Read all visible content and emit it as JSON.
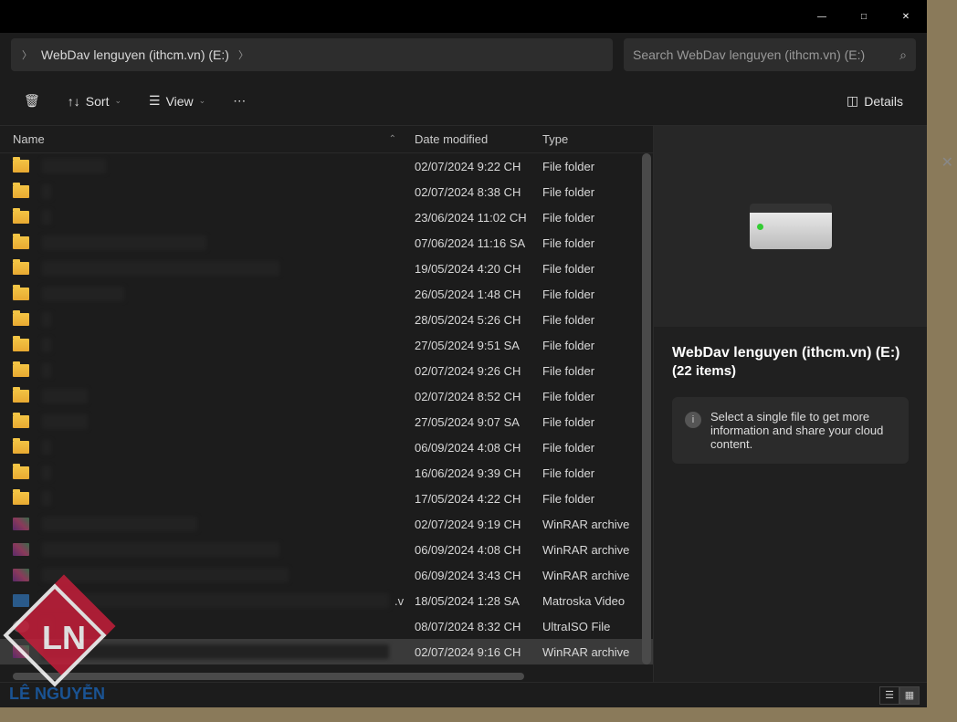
{
  "titlebar": {
    "min": "—",
    "max": "□",
    "close": "✕"
  },
  "breadcrumb": {
    "location": "WebDav lenguyen (ithcm.vn) (E:)"
  },
  "search": {
    "placeholder": "Search WebDav lenguyen (ithcm.vn) (E:)"
  },
  "toolbar": {
    "sort": "Sort",
    "view": "View",
    "details": "Details"
  },
  "columns": {
    "name": "Name",
    "date": "Date modified",
    "type": "Type"
  },
  "rows": [
    {
      "icon": "folder",
      "date": "02/07/2024 9:22 CH",
      "type": "File folder",
      "name_redacted": true,
      "rw": 70
    },
    {
      "icon": "folder",
      "date": "02/07/2024 8:38 CH",
      "type": "File folder",
      "name_redacted": true,
      "rw": 10
    },
    {
      "icon": "folder",
      "date": "23/06/2024 11:02 CH",
      "type": "File folder",
      "name_redacted": true,
      "rw": 10
    },
    {
      "icon": "folder",
      "date": "07/06/2024 11:16 SA",
      "type": "File folder",
      "name_redacted": true,
      "rw": 180
    },
    {
      "icon": "folder",
      "date": "19/05/2024 4:20 CH",
      "type": "File folder",
      "name_redacted": true,
      "rw": 260
    },
    {
      "icon": "folder",
      "date": "26/05/2024 1:48 CH",
      "type": "File folder",
      "name_redacted": true,
      "rw": 90
    },
    {
      "icon": "folder",
      "date": "28/05/2024 5:26 CH",
      "type": "File folder",
      "name_redacted": true,
      "rw": 10
    },
    {
      "icon": "folder",
      "date": "27/05/2024 9:51 SA",
      "type": "File folder",
      "name_redacted": true,
      "rw": 10
    },
    {
      "icon": "folder",
      "date": "02/07/2024 9:26 CH",
      "type": "File folder",
      "name_redacted": true,
      "rw": 10
    },
    {
      "icon": "folder",
      "date": "02/07/2024 8:52 CH",
      "type": "File folder",
      "name_redacted": true,
      "rw": 50
    },
    {
      "icon": "folder",
      "date": "27/05/2024 9:07 SA",
      "type": "File folder",
      "name_redacted": true,
      "rw": 50
    },
    {
      "icon": "folder",
      "date": "06/09/2024 4:08 CH",
      "type": "File folder",
      "name_redacted": true,
      "rw": 10
    },
    {
      "icon": "folder",
      "date": "16/06/2024 9:39 CH",
      "type": "File folder",
      "name_redacted": true,
      "rw": 10
    },
    {
      "icon": "folder",
      "date": "17/05/2024 4:22 CH",
      "type": "File folder",
      "name_redacted": true,
      "rw": 10
    },
    {
      "icon": "rar",
      "date": "02/07/2024 9:19 CH",
      "type": "WinRAR archive",
      "name_redacted": true,
      "rw": 170
    },
    {
      "icon": "rar",
      "date": "06/09/2024 4:08 CH",
      "type": "WinRAR archive",
      "name_redacted": true,
      "rw": 260
    },
    {
      "icon": "rar",
      "date": "06/09/2024 3:43 CH",
      "type": "WinRAR archive",
      "name_redacted": true,
      "rw": 270
    },
    {
      "icon": "vid",
      "date": "18/05/2024 1:28 SA",
      "type": "Matroska Video",
      "name_redacted": true,
      "rw": 380,
      "suffix": ".v"
    },
    {
      "icon": "iso",
      "date": "08/07/2024 8:32 CH",
      "type": "UltraISO File",
      "name_redacted": true,
      "rw": 10
    },
    {
      "icon": "rar",
      "date": "02/07/2024 9:16 CH",
      "type": "WinRAR archive",
      "name_redacted": true,
      "rw": 380,
      "selected": true
    }
  ],
  "details": {
    "title": "WebDav lenguyen (ithcm.vn) (E:)",
    "sub": "(22 items)",
    "info": "Select a single file to get more information and share your cloud content."
  },
  "watermark": {
    "initials": "LN",
    "brand": "LÊ NGUYỄN"
  }
}
